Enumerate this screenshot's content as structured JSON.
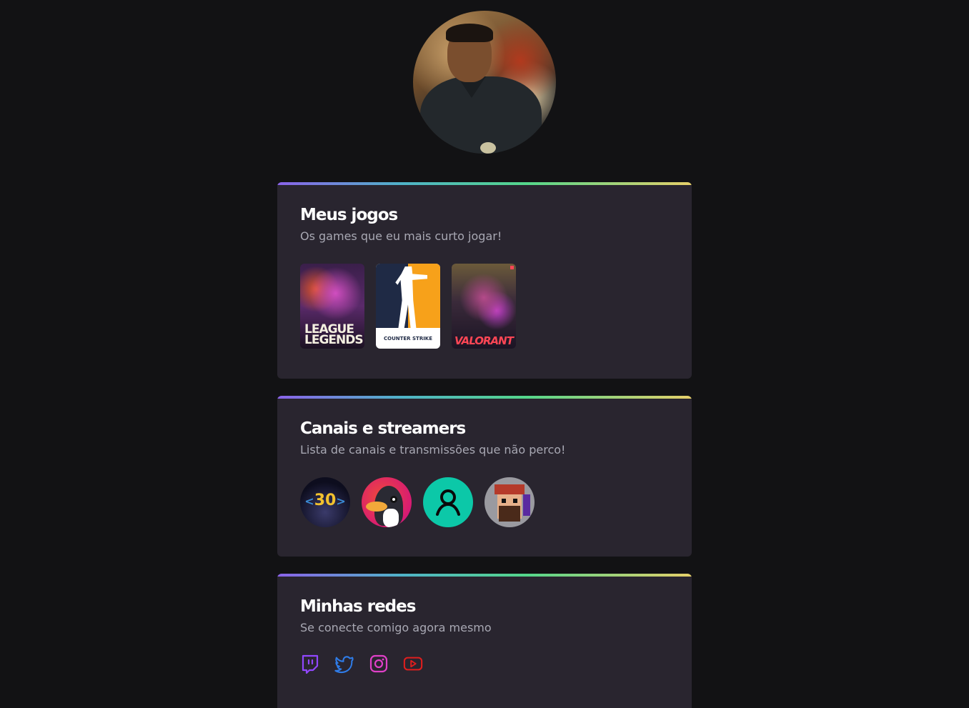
{
  "profile": {
    "avatar_alt": "Foto de perfil"
  },
  "games_card": {
    "title": "Meus jogos",
    "subtitle": "Os games que eu mais curto jogar!",
    "games": [
      {
        "name": "LEAGUE OF LEGENDS",
        "icon": "league-of-legends-cover"
      },
      {
        "name": "COUNTER STRIKE",
        "icon": "counter-strike-cover"
      },
      {
        "name": "VALORANT",
        "icon": "valorant-cover"
      }
    ]
  },
  "channels_card": {
    "title": "Canais e streamers",
    "subtitle": "Lista de canais e transmissões que não perco!",
    "channels": [
      {
        "badge_text": "30",
        "icon": "channel-30-avatar"
      },
      {
        "icon": "penguin-avatar"
      },
      {
        "icon": "default-user-avatar"
      },
      {
        "icon": "pixel-pirate-avatar"
      }
    ]
  },
  "social_card": {
    "title": "Minhas redes",
    "subtitle": "Se conecte comigo agora mesmo",
    "networks": [
      {
        "name": "twitch",
        "icon": "twitch-icon",
        "color": "#9147ff"
      },
      {
        "name": "twitter",
        "icon": "twitter-icon",
        "color": "#2f7ce8"
      },
      {
        "name": "instagram",
        "icon": "instagram-icon",
        "color": "#e040c8"
      },
      {
        "name": "youtube",
        "icon": "youtube-icon",
        "color": "#e01e1e"
      }
    ]
  },
  "colors": {
    "background": "#121214",
    "card": "#29252f",
    "gradient": [
      "#8a63e9",
      "#4fb3c8",
      "#54d68b",
      "#e6d06a"
    ]
  }
}
